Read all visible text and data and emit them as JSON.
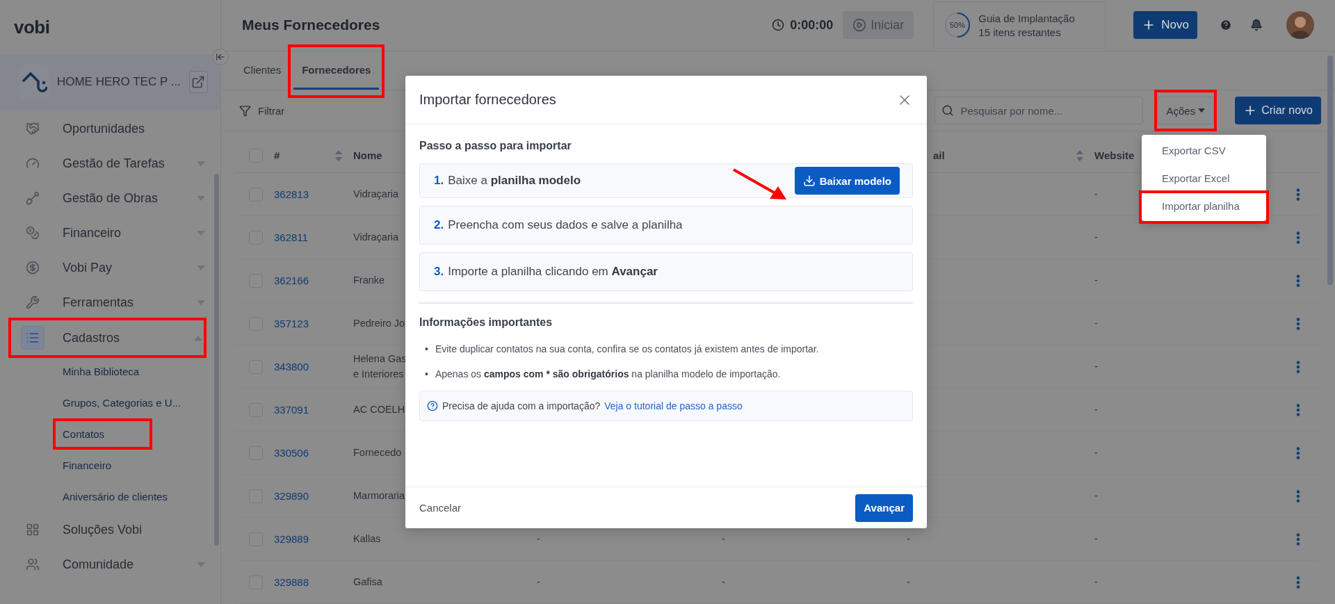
{
  "brand": "vobi",
  "company": {
    "name": "HOME HERO TEC P ..."
  },
  "sidebar": {
    "items": [
      {
        "label": "Oportunidades",
        "kind": "link",
        "selected": false,
        "highlighted": false
      },
      {
        "label": "Gestão de Tarefas",
        "kind": "group",
        "expanded": false,
        "selected": false,
        "highlighted": false
      },
      {
        "label": "Gestão de Obras",
        "kind": "group",
        "expanded": false,
        "selected": false,
        "highlighted": false
      },
      {
        "label": "Financeiro",
        "kind": "group",
        "expanded": false,
        "selected": false,
        "highlighted": false
      },
      {
        "label": "Vobi Pay",
        "kind": "group",
        "expanded": false,
        "selected": false,
        "highlighted": false
      },
      {
        "label": "Ferramentas",
        "kind": "group",
        "expanded": false,
        "selected": false,
        "highlighted": false
      },
      {
        "label": "Cadastros",
        "kind": "group",
        "expanded": true,
        "selected": true,
        "highlighted": true,
        "children": [
          {
            "label": "Minha Biblioteca",
            "highlighted": false
          },
          {
            "label": "Grupos, Categorias e U...",
            "highlighted": false
          },
          {
            "label": "Contatos",
            "highlighted": true
          },
          {
            "label": "Financeiro",
            "highlighted": false
          },
          {
            "label": "Aniversário de clientes",
            "highlighted": false
          }
        ]
      },
      {
        "label": "Soluções Vobi",
        "kind": "link",
        "selected": false,
        "highlighted": false
      },
      {
        "label": "Comunidade",
        "kind": "group",
        "expanded": false,
        "selected": false,
        "highlighted": false
      }
    ]
  },
  "header": {
    "title": "Meus Fornecedores",
    "timer": "0:00:00",
    "start_button": {
      "label": "Iniciar",
      "disabled": true
    },
    "guide": {
      "percent": "50%",
      "level": 0.5,
      "title": "Guia de Implantação",
      "subtitle": "15 itens restantes"
    },
    "new_button": "Novo"
  },
  "tabs": [
    {
      "label": "Clientes",
      "selected": false,
      "highlighted": false
    },
    {
      "label": "Fornecedores",
      "selected": true,
      "highlighted": true
    }
  ],
  "toolbar": {
    "filter": "Filtrar",
    "search": {
      "placeholder": "Pesquisar por nome..."
    },
    "actions": {
      "label": "Ações",
      "highlighted": true
    },
    "create_button": "Criar novo"
  },
  "table": {
    "header_checked": false,
    "columns": [
      {
        "label": "#",
        "sortable": true
      },
      {
        "label": "Nome",
        "sortable": false
      },
      {
        "label": "ail",
        "sortable": true
      },
      {
        "label": "Website",
        "sortable": false
      }
    ],
    "rows": [
      {
        "checked": false,
        "id": "362813",
        "name": [
          "Vidraçaria"
        ],
        "website": "-"
      },
      {
        "checked": false,
        "id": "362811",
        "name": [
          "Vidraçaria"
        ],
        "website": "-"
      },
      {
        "checked": false,
        "id": "362166",
        "name": [
          "Franke"
        ],
        "website": "-"
      },
      {
        "checked": false,
        "id": "357123",
        "name": [
          "Pedreiro Jo"
        ],
        "website": "-"
      },
      {
        "checked": false,
        "id": "343800",
        "name": [
          "Helena Gas",
          "e Interiores"
        ],
        "website": "-"
      },
      {
        "checked": false,
        "id": "337091",
        "name": [
          "AC COELH"
        ],
        "website": "-"
      },
      {
        "checked": false,
        "id": "330506",
        "name": [
          "Fornecedo"
        ],
        "website": "-"
      },
      {
        "checked": false,
        "id": "329890",
        "name": [
          "Marmoraria"
        ],
        "website": "-"
      },
      {
        "checked": false,
        "id": "329889",
        "name": [
          "Kallas"
        ],
        "column_3": "-",
        "column_4": "-",
        "email": "-",
        "website": "-"
      },
      {
        "checked": false,
        "id": "329888",
        "name": [
          "Gafisa"
        ],
        "column_3": "-",
        "column_4": "-",
        "email": "-",
        "website": "-"
      }
    ]
  },
  "actions_menu": [
    {
      "label": "Exportar CSV",
      "highlighted": false
    },
    {
      "label": "Exportar Excel",
      "highlighted": false
    },
    {
      "label": "Importar planilha",
      "highlighted": true
    }
  ],
  "modal": {
    "title": "Importar fornecedores",
    "steps_title": "Passo a passo para importar",
    "steps": [
      {
        "number": "1.",
        "text": "Baixe a **planilha modelo**",
        "button": "Baixar modelo"
      },
      {
        "number": "2.",
        "text": "Preencha com seus dados e salve a planilha"
      },
      {
        "number": "3.",
        "text": "Importe a planilha clicando em **Avançar**"
      }
    ],
    "info_title": "Informações importantes",
    "info": [
      {
        "bullet": "•",
        "text": "Evite duplicar contatos na sua conta, confira se os contatos já existem antes de importar."
      },
      {
        "bullet": "•",
        "text": "Apenas os **campos com * são obrigatórios** na planilha modelo de importação."
      }
    ],
    "help": {
      "text": "Precisa de ajuda com a importação?",
      "link": "Veja o tutorial de passo a passo"
    },
    "cancel": "Cancelar",
    "next": "Avançar"
  }
}
